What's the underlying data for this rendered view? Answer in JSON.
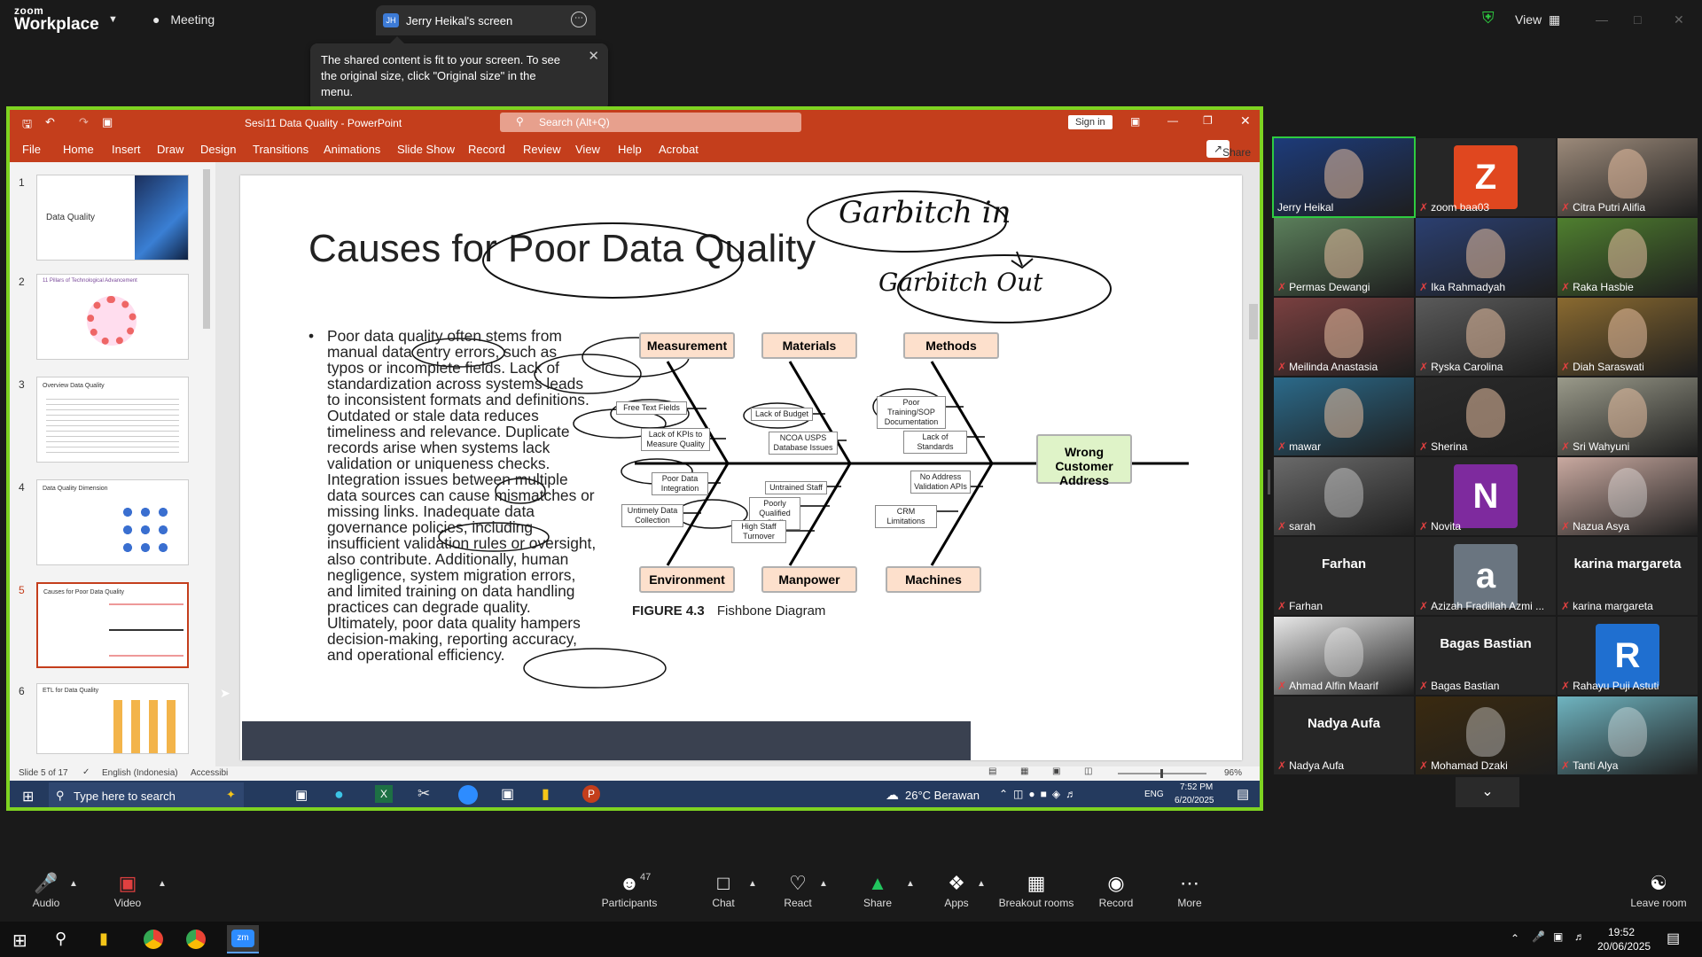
{
  "zoom": {
    "logo_line1": "zoom",
    "logo_line2": "Workplace",
    "meeting_label": "Meeting",
    "screen_tab_initials": "JH",
    "screen_tab_label": "Jerry Heikal's screen",
    "view_label": "View",
    "tooltip": "The shared content is fit to your screen. To see the original size, click \"Original size\" in the menu."
  },
  "ppt": {
    "title": "Sesi11 Data Quality  -  PowerPoint",
    "search_placeholder": "Search (Alt+Q)",
    "sign_in": "Sign in",
    "share": "Share",
    "menu": [
      "File",
      "Home",
      "Insert",
      "Draw",
      "Design",
      "Transitions",
      "Animations",
      "Slide Show",
      "Record",
      "Review",
      "View",
      "Help",
      "Acrobat"
    ],
    "thumbnails": [
      {
        "num": "1",
        "title": "Data Quality"
      },
      {
        "num": "2",
        "title": "11 Pillars of Technological Advancement"
      },
      {
        "num": "3",
        "title": "Overview Data Quality"
      },
      {
        "num": "4",
        "title": "Data Quality Dimension"
      },
      {
        "num": "5",
        "title": "Causes for Poor Data Quality"
      },
      {
        "num": "6",
        "title": "ETL for Data Quality"
      }
    ],
    "status": {
      "slide_of": "Slide 5 of 17",
      "language": "English (Indonesia)",
      "accessibility": "Accessibi",
      "zoom": "96%"
    },
    "taskbar": {
      "search": "Type here to search",
      "weather": "26°C  Berawan",
      "lang": "ENG",
      "time": "7:52 PM",
      "date": "6/20/2025"
    }
  },
  "slide": {
    "title": "Causes for Poor Data Quality",
    "handwriting1": "Garbitch in",
    "handwriting2": "Garbitch Out",
    "body": "Poor data quality often stems from manual data entry errors, such as typos or incomplete fields. Lack of standardization across systems leads to inconsistent formats and definitions. Outdated or stale data reduces timeliness and relevance. Duplicate records arise when systems lack validation or uniqueness checks. Integration issues between multiple data sources can cause mismatches or missing links. Inadequate data governance policies, including insufficient validation rules or oversight, also contribute. Additionally, human negligence, system migration errors, and limited training on data handling practices can degrade quality. Ultimately, poor data quality hampers decision-making, reporting accuracy, and operational efficiency.",
    "fishbone": {
      "categories_top": [
        "Measurement",
        "Materials",
        "Methods"
      ],
      "categories_bottom": [
        "Environment",
        "Manpower",
        "Machines"
      ],
      "effect": "Wrong Customer Address",
      "causes": {
        "measurement": [
          "Free Text Fields",
          "Lack of KPIs to Measure Quality"
        ],
        "materials": [
          "Lack of Budget",
          "NCOA USPS Database Issues"
        ],
        "methods": [
          "Poor Training/SOP Documentation",
          "Lack of Standards"
        ],
        "environment": [
          "Poor Data Integration",
          "Untimely Data Collection"
        ],
        "manpower": [
          "Untrained Staff",
          "Poorly Qualified Staff",
          "High Staff Turnover"
        ],
        "machines": [
          "No Address Validation APIs",
          "CRM Limitations"
        ]
      },
      "caption_num": "FIGURE 4.3",
      "caption_text": "Fishbone Diagram"
    }
  },
  "participants": [
    {
      "name": "Jerry Heikal",
      "type": "video",
      "color": "#1d3b7a"
    },
    {
      "name": "zoom baa03",
      "type": "letter",
      "letter": "Z",
      "color": "#e0471f"
    },
    {
      "name": "Citra Putri Alifia",
      "type": "video",
      "color": "#9c8a7a"
    },
    {
      "name": "Permas Dewangi",
      "type": "video",
      "color": "#5b7f5b"
    },
    {
      "name": "Ika Rahmadyah",
      "type": "video",
      "color": "#2b3f70"
    },
    {
      "name": "Raka Hasbie",
      "type": "video",
      "color": "#4f7f2f"
    },
    {
      "name": "Meilinda Anastasia",
      "type": "video",
      "color": "#7a4040"
    },
    {
      "name": "Ryska Carolina",
      "type": "video",
      "color": "#5a5a5a"
    },
    {
      "name": "Diah Saraswati",
      "type": "video",
      "color": "#8a6a30"
    },
    {
      "name": "mawar",
      "type": "video",
      "color": "#2b6a8a"
    },
    {
      "name": "Sherina",
      "type": "video",
      "color": "#2a2a2a"
    },
    {
      "name": "Sri Wahyuni",
      "type": "video",
      "color": "#9a9a8a"
    },
    {
      "name": "sarah",
      "type": "photo",
      "color": "#6a6a6a"
    },
    {
      "name": "Novita",
      "type": "letter",
      "letter": "N",
      "color": "#7e2a9e"
    },
    {
      "name": "Nazua Asya",
      "type": "photo",
      "color": "#c9a9a0"
    },
    {
      "name": "Farhan",
      "type": "text",
      "big": "Farhan"
    },
    {
      "name": "Azizah Fradillah Azmi ...",
      "type": "letter",
      "letter": "a",
      "color": "#6a7580"
    },
    {
      "name": "karina margareta",
      "type": "text",
      "big": "karina margareta"
    },
    {
      "name": "Ahmad Alfin Maarif",
      "type": "photo",
      "color": "#e8e8e8"
    },
    {
      "name": "Bagas Bastian",
      "type": "text",
      "big": "Bagas Bastian"
    },
    {
      "name": "Rahayu Puji Astuti",
      "type": "letter",
      "letter": "R",
      "color": "#1f6fd0"
    },
    {
      "name": "Nadya Aufa",
      "type": "text",
      "big": "Nadya Aufa"
    },
    {
      "name": "Mohamad Dzaki",
      "type": "photo",
      "color": "#3a2a10"
    },
    {
      "name": "Tanti Alya",
      "type": "photo",
      "color": "#6fb4c0"
    }
  ],
  "toolbar": {
    "audio": "Audio",
    "video": "Video",
    "participants": "Participants",
    "participants_count": "47",
    "chat": "Chat",
    "react": "React",
    "share": "Share",
    "apps": "Apps",
    "breakout": "Breakout rooms",
    "record": "Record",
    "more": "More",
    "leave": "Leave room"
  },
  "windows": {
    "time": "19:52",
    "date": "20/06/2025"
  }
}
